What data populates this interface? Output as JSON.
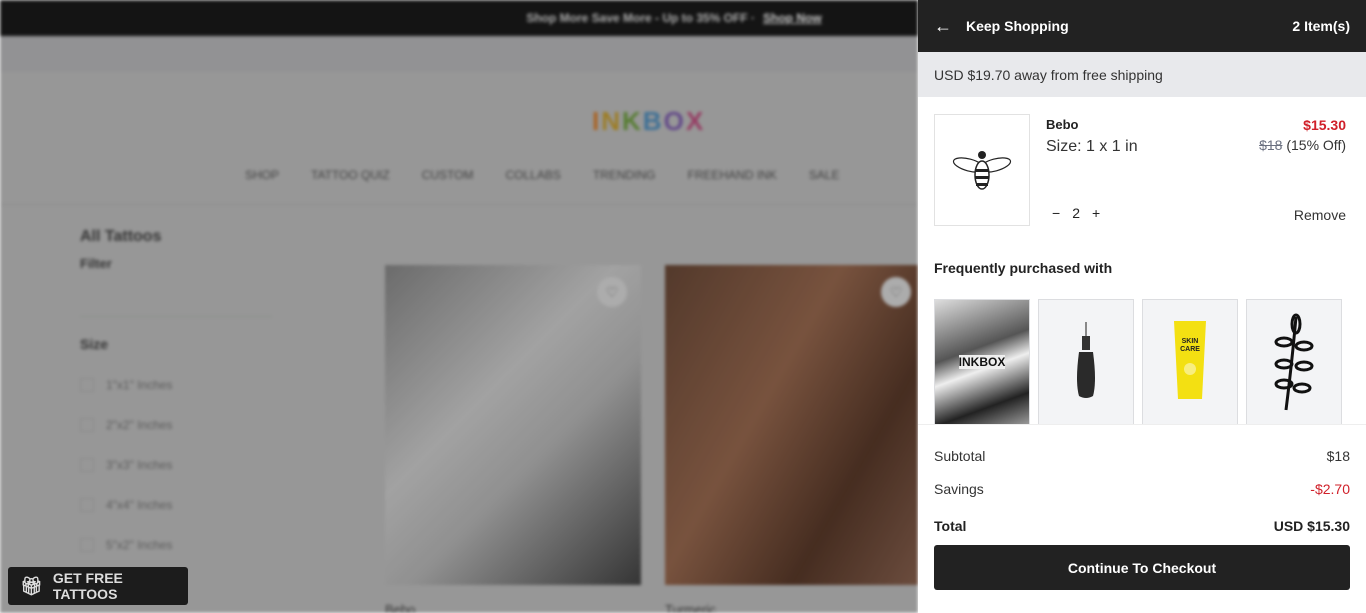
{
  "background": {
    "promo_text": "Shop More Save More - Up to 35% OFF ·",
    "promo_link": "Shop Now",
    "logo": "INKBOX",
    "nav": [
      "SHOP",
      "TATTOO QUIZ",
      "CUSTOM",
      "COLLABS",
      "TRENDING",
      "FREEHAND INK",
      "SALE"
    ],
    "page_title": "All Tattoos",
    "filter_label": "Filter",
    "size_label": "Size",
    "size_options": [
      "1\"x1\" Inches",
      "2\"x2\" Inches",
      "3\"x3\" Inches",
      "4\"x4\" Inches",
      "5\"x2\" Inches"
    ],
    "products": [
      "Bebo",
      "Turmeric"
    ],
    "gift_button": "GET FREE TATTOOS"
  },
  "cart": {
    "header": {
      "back_label": "Keep Shopping",
      "item_count": "2 Item(s)"
    },
    "shipping_notice": "USD $19.70 away from free shipping",
    "item": {
      "name": "Bebo",
      "size": "Size: 1 x 1 in",
      "price": "$15.30",
      "original_price": "$18",
      "discount": "(15% Off)",
      "quantity": "2",
      "remove_label": "Remove"
    },
    "frequently_title": "Frequently purchased with",
    "recommendations": [
      "inkbox-collage",
      "freehand-ink-bottle",
      "skin-care-tube",
      "leaf-tattoo"
    ],
    "summary": {
      "subtotal_label": "Subtotal",
      "subtotal": "$18",
      "savings_label": "Savings",
      "savings": "-$2.70",
      "total_label": "Total",
      "total": "USD $15.30"
    },
    "checkout_label": "Continue To Checkout"
  },
  "colors": {
    "accent_red": "#d0202a",
    "dark": "#222222",
    "overlay": "rgba(0,0,0,0.25)"
  }
}
